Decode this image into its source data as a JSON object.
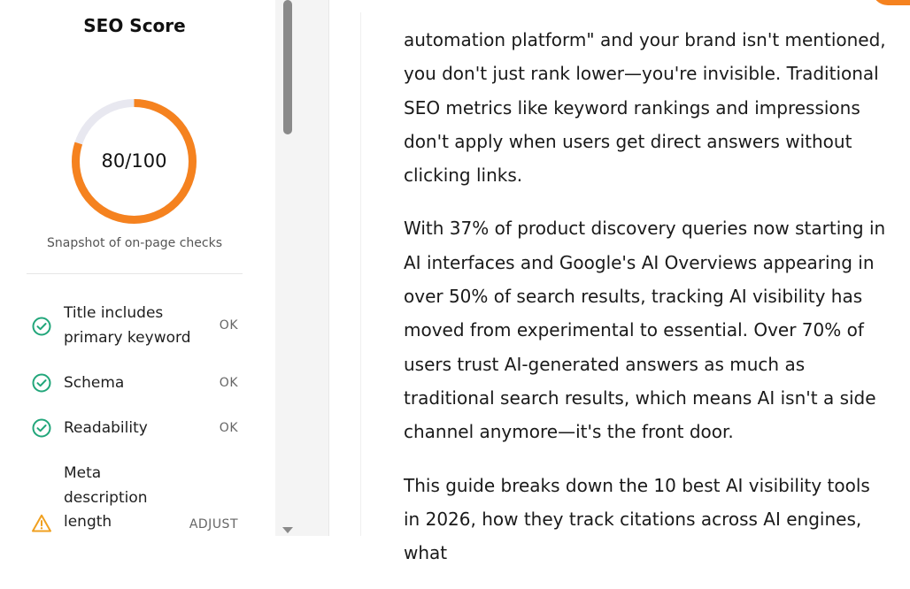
{
  "sidebar": {
    "title": "SEO Score",
    "score": {
      "value": 80,
      "max": 100,
      "label": "80/100"
    },
    "subtitle": "Snapshot of on-page checks",
    "checks": [
      {
        "label": "Title includes primary keyword",
        "status": "OK",
        "state": "pass"
      },
      {
        "label": "Schema",
        "status": "OK",
        "state": "pass"
      },
      {
        "label": "Readability",
        "status": "OK",
        "state": "pass"
      },
      {
        "label": "Meta description length",
        "status": "ADJUST",
        "state": "warning"
      }
    ]
  },
  "article": {
    "paragraphs": [
      "automation platform\" and your brand isn't mentioned, you don't just rank lower—you're invisible. Traditional SEO metrics like keyword rankings and impressions don't apply when users get direct answers without clicking links.",
      "With 37% of product discovery queries now starting in AI interfaces and Google's AI Overviews appearing in over 50% of search results, tracking AI visibility has moved from experimental to essential. Over 70% of users trust AI-generated answers as much as traditional search results, which means AI isn't a side channel anymore—it's the front door.",
      "This guide breaks down the 10 best AI visibility tools in 2026, how they track citations across AI engines, what"
    ]
  },
  "colors": {
    "accent": "#f5821f",
    "gauge_track": "#e8e8f0",
    "pass": "#21a67a",
    "warning": "#f0a020"
  },
  "icons": {
    "pass": "check-circle-icon",
    "warning": "warning-triangle-icon"
  }
}
